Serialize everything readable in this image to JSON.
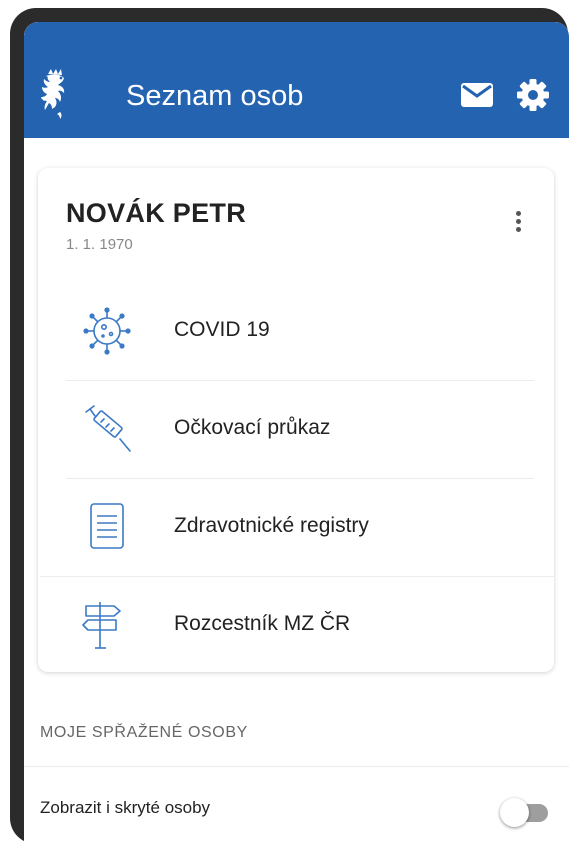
{
  "appbar": {
    "title": "Seznam osob",
    "logo_icon": "czech-lion-icon",
    "mail_icon": "mail-icon",
    "settings_icon": "gear-icon",
    "color": "#2463b0"
  },
  "person": {
    "name": "NOVÁK PETR",
    "dob": "1. 1. 1970",
    "menu_icon": "more-vertical-icon"
  },
  "menu": [
    {
      "label": "COVID 19",
      "icon": "virus-icon"
    },
    {
      "label": "Očkovací průkaz",
      "icon": "syringe-icon"
    },
    {
      "label": "Zdravotnické registry",
      "icon": "document-icon"
    },
    {
      "label": "Rozcestník MZ ČR",
      "icon": "signpost-icon"
    }
  ],
  "linked": {
    "section_title": "MOJE SPŘAŽENÉ OSOBY",
    "toggle_label": "Zobrazit i skryté osoby",
    "toggle_on": false
  },
  "colors": {
    "accent": "#2463b0",
    "icon": "#3b7ac6"
  }
}
